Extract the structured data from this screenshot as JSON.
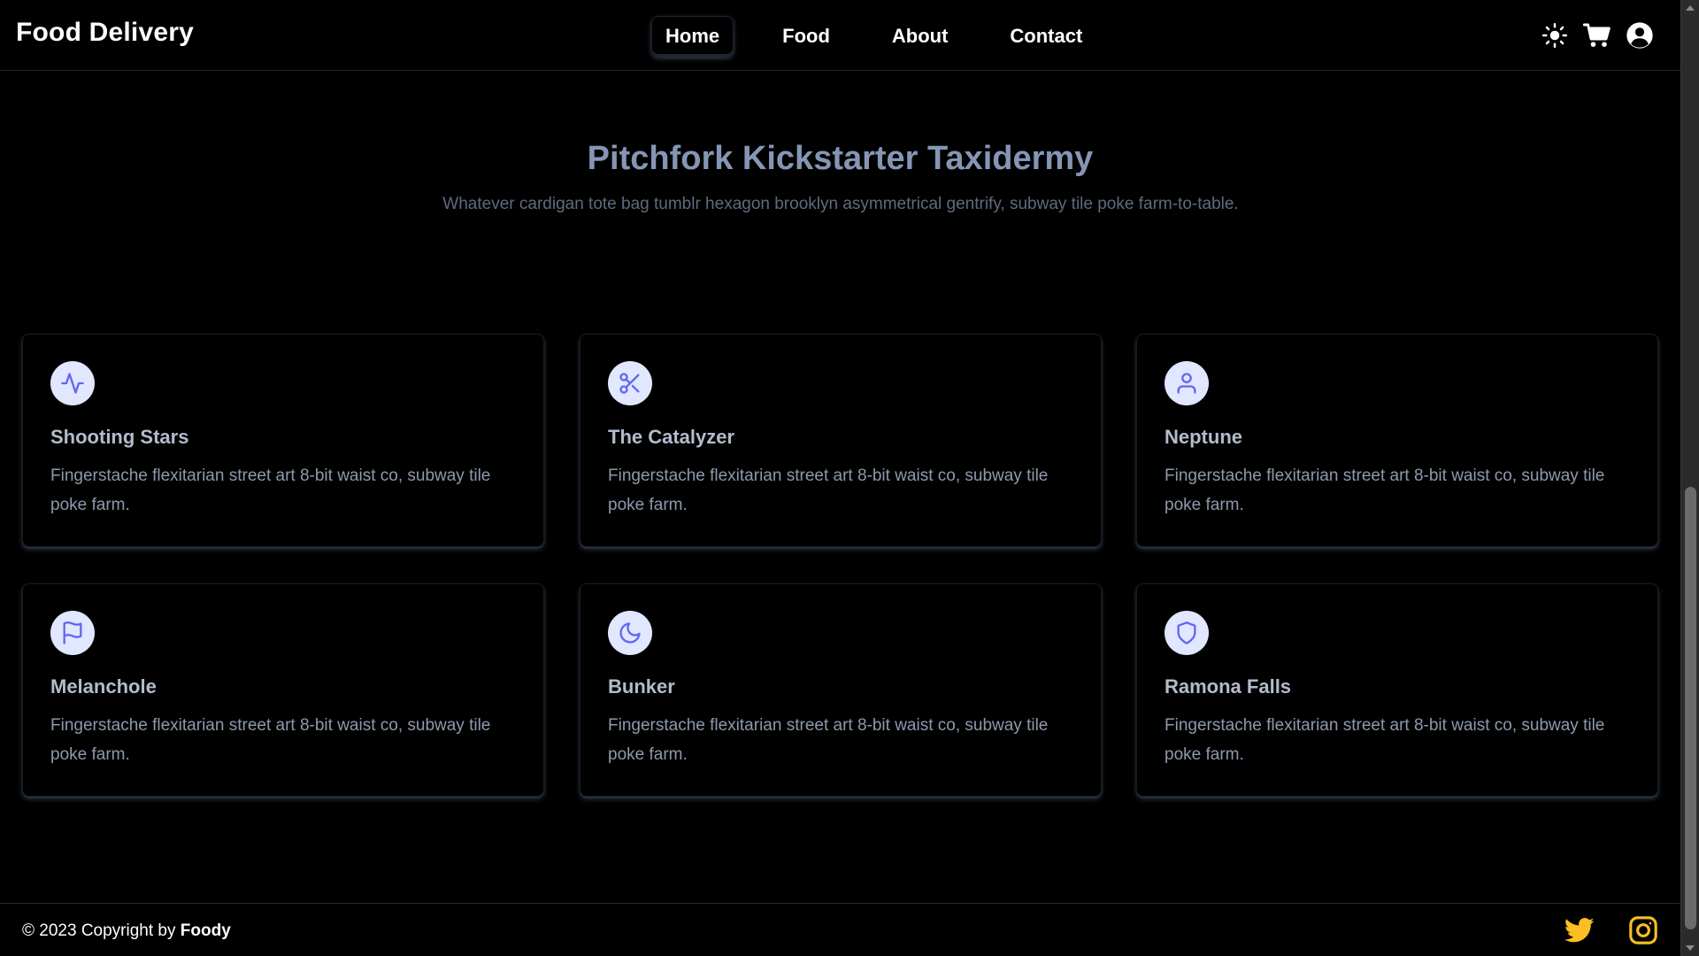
{
  "brand": {
    "name": "Food Delivery"
  },
  "nav": {
    "items": [
      {
        "label": "Home",
        "active": true
      },
      {
        "label": "Food",
        "active": false
      },
      {
        "label": "About",
        "active": false
      },
      {
        "label": "Contact",
        "active": false
      }
    ]
  },
  "header_icons": [
    "sun-icon",
    "cart-icon",
    "user-circle-icon"
  ],
  "hero": {
    "title": "Pitchfork Kickstarter Taxidermy",
    "description": "Whatever cardigan tote bag tumblr hexagon brooklyn asymmetrical gentrify, subway tile poke farm-to-table."
  },
  "features": [
    {
      "icon": "activity-icon",
      "title": "Shooting Stars",
      "text": "Fingerstache flexitarian street art 8-bit waist co, subway tile poke farm."
    },
    {
      "icon": "scissors-icon",
      "title": "The Catalyzer",
      "text": "Fingerstache flexitarian street art 8-bit waist co, subway tile poke farm."
    },
    {
      "icon": "user-icon",
      "title": "Neptune",
      "text": "Fingerstache flexitarian street art 8-bit waist co, subway tile poke farm."
    },
    {
      "icon": "flag-icon",
      "title": "Melanchole",
      "text": "Fingerstache flexitarian street art 8-bit waist co, subway tile poke farm."
    },
    {
      "icon": "moon-icon",
      "title": "Bunker",
      "text": "Fingerstache flexitarian street art 8-bit waist co, subway tile poke farm."
    },
    {
      "icon": "shield-icon",
      "title": "Ramona Falls",
      "text": "Fingerstache flexitarian street art 8-bit waist co, subway tile poke farm."
    }
  ],
  "footer": {
    "copyright_prefix": "© 2023 Copyright by",
    "copyright_brand": "Foody",
    "social": [
      "twitter-icon",
      "instagram-icon"
    ]
  },
  "colors": {
    "background": "#000000",
    "hero_title": "#8596b4",
    "icon_bg": "#e0e7ff",
    "icon_stroke": "#6366f1",
    "twitter": "#fbbf24",
    "instagram": "#fbbf24"
  }
}
